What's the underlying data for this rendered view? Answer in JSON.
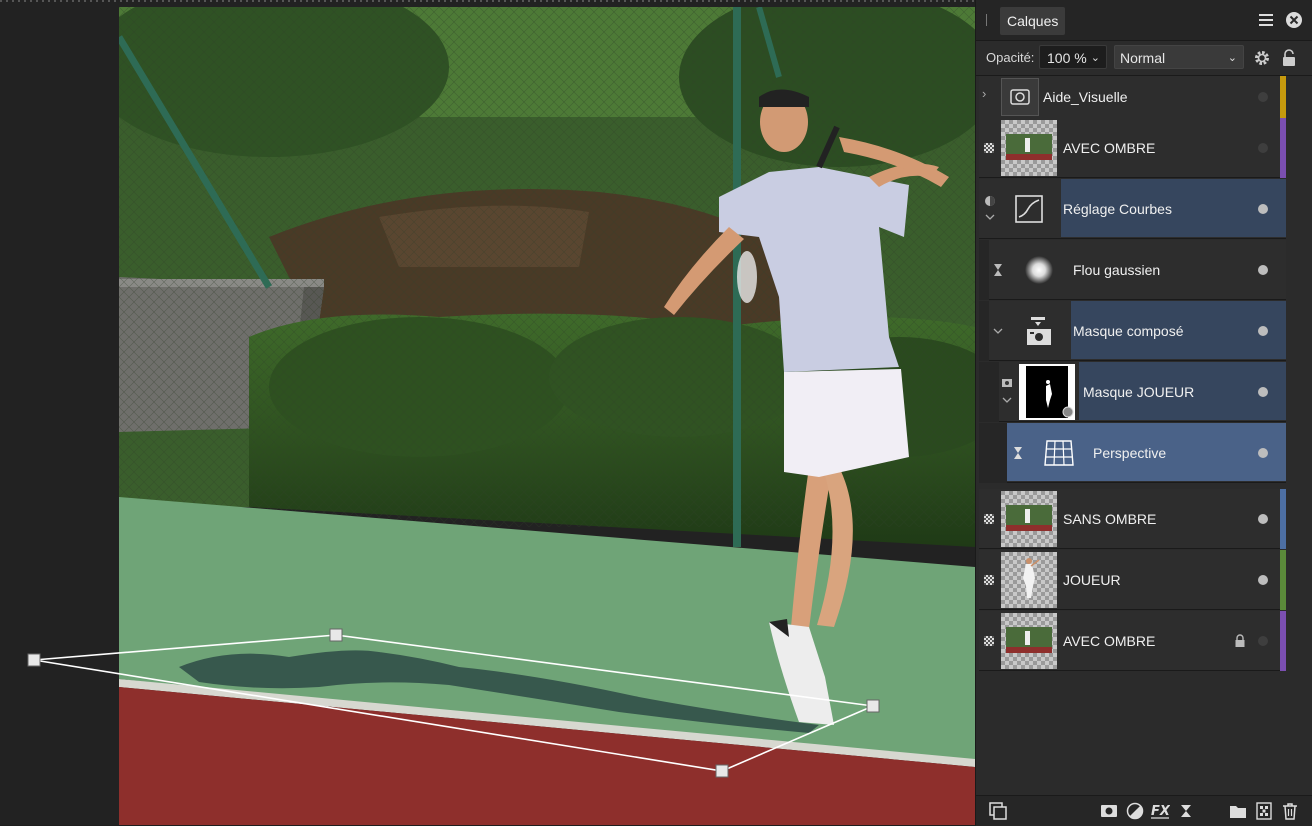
{
  "panel": {
    "tab_label": "Calques",
    "opacity_label": "Opacité:",
    "opacity_value": "100 %",
    "blend_mode": "Normal",
    "layers": [
      {
        "name": "Aide_Visuelle",
        "tag_color": "#c69a0e"
      },
      {
        "name": "AVEC OMBRE",
        "tag_color": "#7b4fb1"
      },
      {
        "name": "Réglage Courbes",
        "tag_color": ""
      },
      {
        "name": "Flou gaussien",
        "tag_color": ""
      },
      {
        "name": "Masque composé",
        "tag_color": ""
      },
      {
        "name": "Masque JOUEUR",
        "tag_color": ""
      },
      {
        "name": "Perspective",
        "tag_color": ""
      },
      {
        "name": "SANS OMBRE",
        "tag_color": "#4d6fa3"
      },
      {
        "name": "JOUEUR",
        "tag_color": "#5b8a3a"
      },
      {
        "name": "AVEC OMBRE",
        "tag_color": "#7b4fb1"
      }
    ],
    "footer_icons": [
      "layer-options-icon",
      "mask-icon",
      "adjustment-icon",
      "fx-icon",
      "live-filter-icon",
      "group-icon",
      "pixel-layer-icon",
      "delete-icon"
    ]
  },
  "colors": {
    "selection": "#4a6288",
    "child_selection": "#36465e",
    "court_green": "#6fa477",
    "court_red": "#8e2f2c"
  }
}
